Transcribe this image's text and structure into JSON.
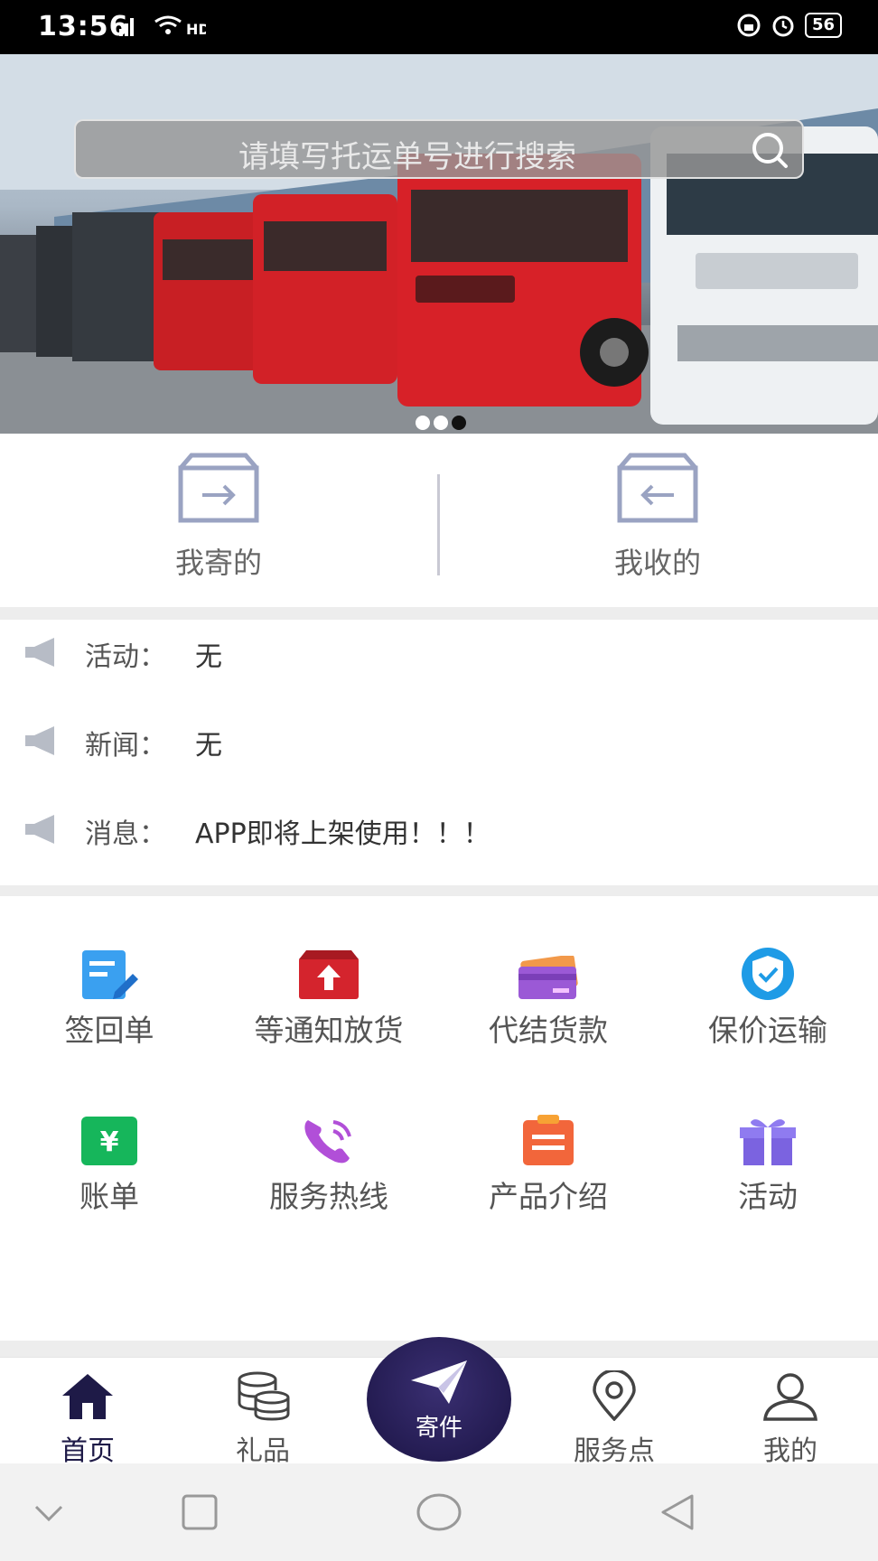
{
  "status_bar": {
    "time": "13:56",
    "signal_text": "4G",
    "battery": "56"
  },
  "search": {
    "placeholder": "请填写托运单号进行搜索"
  },
  "banner": {
    "slides": 3,
    "active_slide": 3
  },
  "shipments": {
    "sent_label": "我寄的",
    "received_label": "我收的"
  },
  "notices": [
    {
      "label": "活动：",
      "value": "无"
    },
    {
      "label": "新闻：",
      "value": "无"
    },
    {
      "label": "消息：",
      "value": "APP即将上架使用！！！"
    }
  ],
  "services": [
    {
      "label": "签回单",
      "icon": "document-edit-icon"
    },
    {
      "label": "等通知放货",
      "icon": "upload-box-icon"
    },
    {
      "label": "代结货款",
      "icon": "credit-card-icon"
    },
    {
      "label": "保价运输",
      "icon": "shield-check-icon"
    },
    {
      "label": "账单",
      "icon": "yuan-bill-icon"
    },
    {
      "label": "服务热线",
      "icon": "phone-icon"
    },
    {
      "label": "产品介绍",
      "icon": "clipboard-icon"
    },
    {
      "label": "活动",
      "icon": "gift-icon"
    }
  ],
  "tabbar": {
    "home": "首页",
    "gifts": "礼品",
    "send": "寄件",
    "service_points": "服务点",
    "mine": "我的"
  },
  "colors": {
    "primary": "#241c52",
    "icon_gray": "#9aa3c2"
  }
}
